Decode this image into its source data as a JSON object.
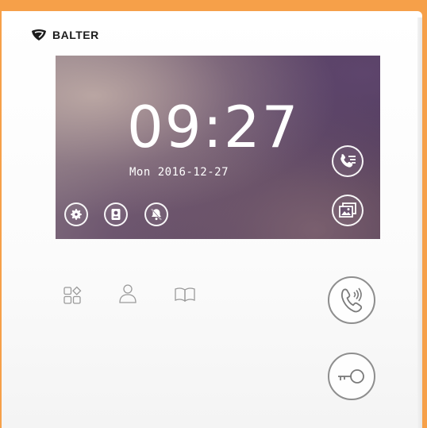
{
  "brand": {
    "name": "BALTER"
  },
  "screen": {
    "time": "09:27",
    "date": "Mon 2016-12-27"
  },
  "colors": {
    "frame": "#f6a049",
    "panel": "#ffffff",
    "screen_text": "#ffffff",
    "button_outline": "#8e8e8e"
  },
  "icons": {
    "screen_left": [
      "settings-icon",
      "door-station-icon",
      "bell-mute-icon"
    ],
    "screen_right": [
      "call-log-icon",
      "gallery-icon"
    ],
    "hardware_touch": [
      "apps-icon",
      "user-icon",
      "book-icon"
    ],
    "hardware_buttons": [
      "answer-call-icon",
      "unlock-key-icon"
    ]
  }
}
